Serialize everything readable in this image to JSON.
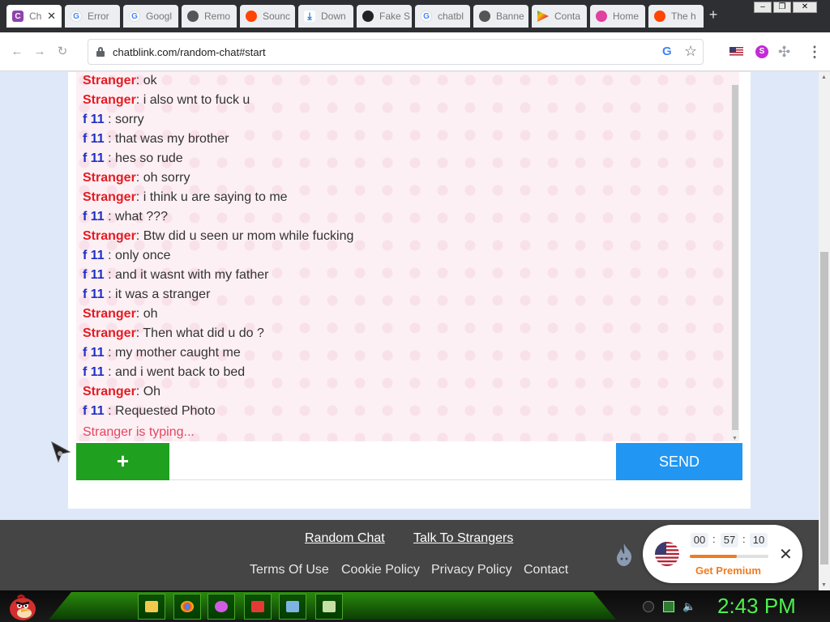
{
  "browser": {
    "tabs": [
      {
        "title": "Ch",
        "icon": "chatblink-icon",
        "active": true
      },
      {
        "title": "Error",
        "icon": "google-icon"
      },
      {
        "title": "Googl",
        "icon": "google-icon"
      },
      {
        "title": "Remo",
        "icon": "globe-icon"
      },
      {
        "title": "Sounc",
        "icon": "reddit-icon"
      },
      {
        "title": "Down",
        "icon": "download-icon"
      },
      {
        "title": "Fake S",
        "icon": "incognito-icon"
      },
      {
        "title": "chatbl",
        "icon": "google-icon"
      },
      {
        "title": "Banne",
        "icon": "globe-icon"
      },
      {
        "title": "Conta",
        "icon": "play-store-icon"
      },
      {
        "title": "Home",
        "icon": "home-icon"
      },
      {
        "title": "The h",
        "icon": "reddit-icon"
      }
    ],
    "new_tab": "+",
    "url": "chatblink.com/random-chat#start"
  },
  "chat": {
    "messages": [
      {
        "sender": "Stranger",
        "text": ": ok",
        "kind": "stranger"
      },
      {
        "sender": "Stranger",
        "text": ": i also wnt to fuck u",
        "kind": "stranger"
      },
      {
        "sender": "f 11",
        "text": " : sorry",
        "kind": "you"
      },
      {
        "sender": "f 11",
        "text": " : that was my brother",
        "kind": "you"
      },
      {
        "sender": "f 11",
        "text": " : hes so rude",
        "kind": "you"
      },
      {
        "sender": "Stranger",
        "text": ": oh sorry",
        "kind": "stranger"
      },
      {
        "sender": "Stranger",
        "text": ": i think u are saying to me",
        "kind": "stranger"
      },
      {
        "sender": "f 11",
        "text": " : what ???",
        "kind": "you"
      },
      {
        "sender": "Stranger",
        "text": ": Btw did u seen ur mom while fucking",
        "kind": "stranger"
      },
      {
        "sender": "f 11",
        "text": " : only once",
        "kind": "you"
      },
      {
        "sender": "f 11",
        "text": " : and it wasnt with my father",
        "kind": "you"
      },
      {
        "sender": "f 11",
        "text": " : it was a stranger",
        "kind": "you"
      },
      {
        "sender": "Stranger",
        "text": ": oh",
        "kind": "stranger"
      },
      {
        "sender": "Stranger",
        "text": ": Then what did u do ?",
        "kind": "stranger"
      },
      {
        "sender": "f 11",
        "text": " : my mother caught me",
        "kind": "you"
      },
      {
        "sender": "f 11",
        "text": " : and i went back to bed",
        "kind": "you"
      },
      {
        "sender": "Stranger",
        "text": ": Oh",
        "kind": "stranger"
      },
      {
        "sender": "f 11",
        "text": " : Requested Photo",
        "kind": "you"
      }
    ],
    "typing": "Stranger is typing...",
    "plus_label": "+",
    "input_value": "",
    "send_label": "SEND"
  },
  "footer": {
    "random_chat": "Random Chat",
    "talk_to_strangers": "Talk To Strangers",
    "terms": "Terms Of Use",
    "cookie": "Cookie Policy",
    "privacy": "Privacy Policy",
    "contact": "Contact"
  },
  "premium": {
    "hours": "00",
    "minutes": "57",
    "seconds": "10",
    "label": "Get Premium",
    "progress": 0.6
  },
  "taskbar": {
    "clock": "2:43 PM"
  }
}
